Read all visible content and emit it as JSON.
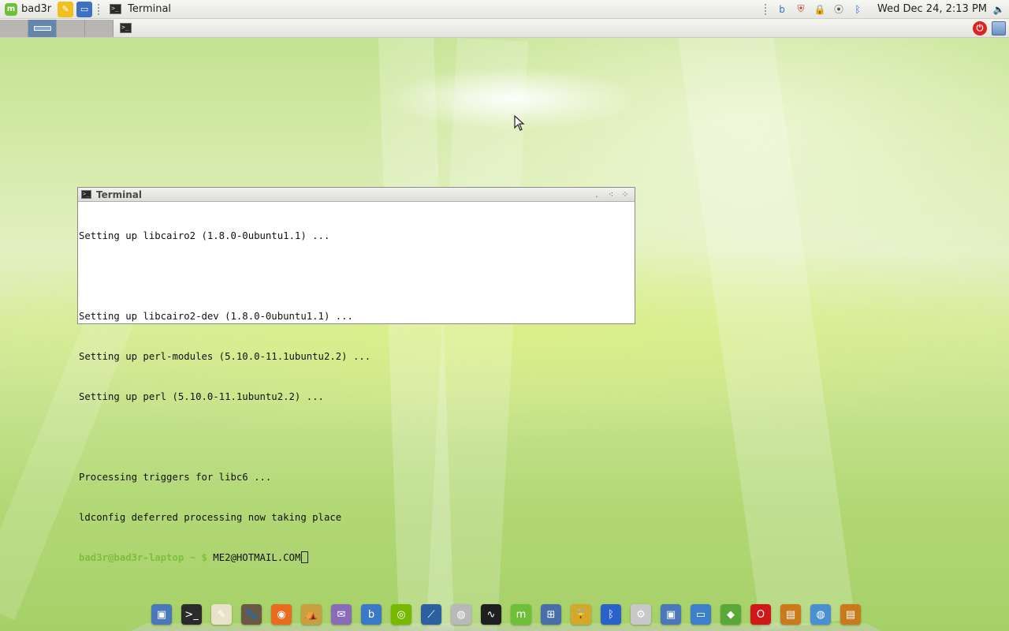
{
  "top_panel": {
    "menu_label": "bad3r",
    "mint_logo_glyph": "m",
    "launchers": [
      {
        "name": "text-editor-icon",
        "color": "#f0c020",
        "glyph": "✎"
      },
      {
        "name": "window-icon",
        "color": "#3d72c0",
        "glyph": "▭"
      }
    ],
    "task_label": "Terminal",
    "tray_icons": [
      {
        "name": "bluetooth-b-icon",
        "color": "#3a6fc0",
        "glyph": "b"
      },
      {
        "name": "update-shield-icon",
        "color": "#c0392b",
        "glyph": "⛨"
      },
      {
        "name": "lock-icon",
        "color": "#8a6d3b",
        "glyph": "🔒"
      },
      {
        "name": "network-antenna-icon",
        "color": "#555555",
        "glyph": "⦿"
      },
      {
        "name": "bluetooth-icon",
        "color": "#2a62c9",
        "glyph": "ᛒ"
      }
    ],
    "clock": "Wed Dec 24,  2:13 PM",
    "volume_glyph": "🔈"
  },
  "second_panel": {
    "workspace_count": 4,
    "active_workspace": 2,
    "power_glyph": "⏻"
  },
  "terminal": {
    "title": "Terminal",
    "buttons": {
      "minimize": ".",
      "maximize": "⁖",
      "close": "⁘"
    },
    "lines": [
      "Setting up libcairo2 (1.8.0-0ubuntu1.1) ...",
      "",
      "Setting up libcairo2-dev (1.8.0-0ubuntu1.1) ...",
      "Setting up perl-modules (5.10.0-11.1ubuntu2.2) ...",
      "Setting up perl (5.10.0-11.1ubuntu2.2) ...",
      "",
      "Processing triggers for libc6 ...",
      "ldconfig deferred processing now taking place"
    ],
    "prompt": {
      "user_host": "bad3r@bad3r-laptop",
      "path": " ~ ",
      "symbol": "$",
      "input": " ME2@HOTMAIL.COM"
    }
  },
  "dock": {
    "icons": [
      {
        "name": "save-disk-icon",
        "color": "#4a78b8",
        "glyph": "▣"
      },
      {
        "name": "terminal-app-icon",
        "color": "#2b2b2b",
        "glyph": ">_"
      },
      {
        "name": "text-editor-app-icon",
        "color": "#e8e2c8",
        "glyph": "✎"
      },
      {
        "name": "gimp-icon",
        "color": "#6a5a44",
        "glyph": "🐾"
      },
      {
        "name": "firefox-icon",
        "color": "#e86b1f",
        "glyph": "◉"
      },
      {
        "name": "transmission-icon",
        "color": "#c9a040",
        "glyph": "⛺"
      },
      {
        "name": "pidgin-icon",
        "color": "#8a6bb8",
        "glyph": "✉"
      },
      {
        "name": "bluefish-icon",
        "color": "#3c78c8",
        "glyph": "b"
      },
      {
        "name": "nvidia-icon",
        "color": "#76b900",
        "glyph": "◎"
      },
      {
        "name": "system-graph-icon",
        "color": "#2e5f9e",
        "glyph": "⟋"
      },
      {
        "name": "media-player-icon",
        "color": "#b8b8b8",
        "glyph": "◍"
      },
      {
        "name": "system-monitor-icon",
        "color": "#1f1f1f",
        "glyph": "∿"
      },
      {
        "name": "mint-menu-icon",
        "color": "#6fbf3a",
        "glyph": "m"
      },
      {
        "name": "network-manager-icon",
        "color": "#4a6fa8",
        "glyph": "⊞"
      },
      {
        "name": "security-lock-icon",
        "color": "#d4a82c",
        "glyph": "🔒"
      },
      {
        "name": "bluetooth-app-icon",
        "color": "#2a62c9",
        "glyph": "ᛒ"
      },
      {
        "name": "settings-window-icon",
        "color": "#c8c8c8",
        "glyph": "⚙"
      },
      {
        "name": "disk-utility-icon",
        "color": "#4a78b8",
        "glyph": "▣"
      },
      {
        "name": "desktop-icon",
        "color": "#3d7fc8",
        "glyph": "▭"
      },
      {
        "name": "xchat-icon",
        "color": "#5aa83a",
        "glyph": "◆"
      },
      {
        "name": "opera-icon",
        "color": "#d01818",
        "glyph": "O"
      },
      {
        "name": "book-icon",
        "color": "#c97a1a",
        "glyph": "▤"
      },
      {
        "name": "chromium-icon",
        "color": "#4a90d0",
        "glyph": "◍"
      },
      {
        "name": "notebook-icon",
        "color": "#c97a1a",
        "glyph": "▤"
      }
    ]
  }
}
